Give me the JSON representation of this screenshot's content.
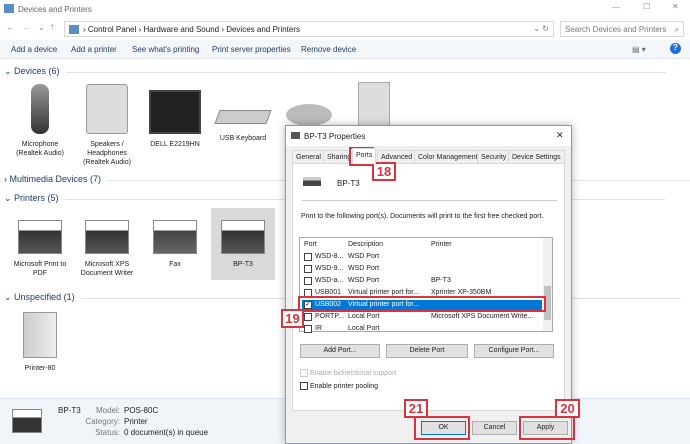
{
  "window": {
    "title": "Devices and Printers"
  },
  "address": {
    "crumbs": [
      "Control Panel",
      "Hardware and Sound",
      "Devices and Printers"
    ],
    "search_placeholder": "Search Devices and Printers"
  },
  "toolbar": {
    "items": [
      "Add a device",
      "Add a printer",
      "See what's printing",
      "Print server properties",
      "Remove device"
    ]
  },
  "sections": {
    "devices": {
      "title": "Devices (6)",
      "items": [
        "Microphone (Realtek Audio)",
        "Speakers / Headphones (Realtek Audio)",
        "DELL E2219HN",
        "USB Keyboard"
      ]
    },
    "multimedia": {
      "title": "Multimedia Devices (7)"
    },
    "printers": {
      "title": "Printers (5)",
      "items": [
        "Microsoft Print to PDF",
        "Microsoft XPS Document Writer",
        "Fax",
        "BP-T3"
      ]
    },
    "unspecified": {
      "title": "Unspecified (1)",
      "items": [
        "Printer-80"
      ]
    }
  },
  "details": {
    "name": "BP-T3",
    "model_label": "Model:",
    "model": "POS-80C",
    "category_label": "Category:",
    "category": "Printer",
    "status_label": "Status:",
    "status": "0 document(s) in queue"
  },
  "dialog": {
    "title": "BP-T3 Properties",
    "close": "✕",
    "tabs": [
      "General",
      "Sharing",
      "Ports",
      "Advanced",
      "Color Management",
      "Security",
      "Device Settings"
    ],
    "printer_name": "BP-T3",
    "instructions": "Print to the following port(s). Documents will print to the first free checked port.",
    "columns": [
      "Port",
      "Description",
      "Printer"
    ],
    "rows": [
      {
        "port": "WSD-8...",
        "desc": "WSD Port",
        "printer": "",
        "checked": false
      },
      {
        "port": "WSD-9...",
        "desc": "WSD Port",
        "printer": "",
        "checked": false
      },
      {
        "port": "WSD-a...",
        "desc": "WSD Port",
        "printer": "BP-T3",
        "checked": false
      },
      {
        "port": "USB001",
        "desc": "Virtual printer port for...",
        "printer": "Xprinter XP-350BM",
        "checked": false
      },
      {
        "port": "USB002",
        "desc": "Virtual printer port for...",
        "printer": "",
        "checked": true
      },
      {
        "port": "PORTP...",
        "desc": "Local Port",
        "printer": "Microsoft XPS Document Write...",
        "checked": false
      },
      {
        "port": "IR",
        "desc": "Local Port",
        "printer": "",
        "checked": false
      }
    ],
    "add_port": "Add Port...",
    "delete_port": "Delete Port",
    "configure_port": "Configure Port...",
    "bidirectional": "Enable bidirectional support",
    "pooling": "Enable printer pooling",
    "ok": "OK",
    "cancel": "Cancel",
    "apply": "Apply"
  },
  "annotations": {
    "a18": "18",
    "a19": "19",
    "a20": "20",
    "a21": "21"
  },
  "colors": {
    "selection": "#0078d7",
    "annotation": "#d9333f"
  }
}
